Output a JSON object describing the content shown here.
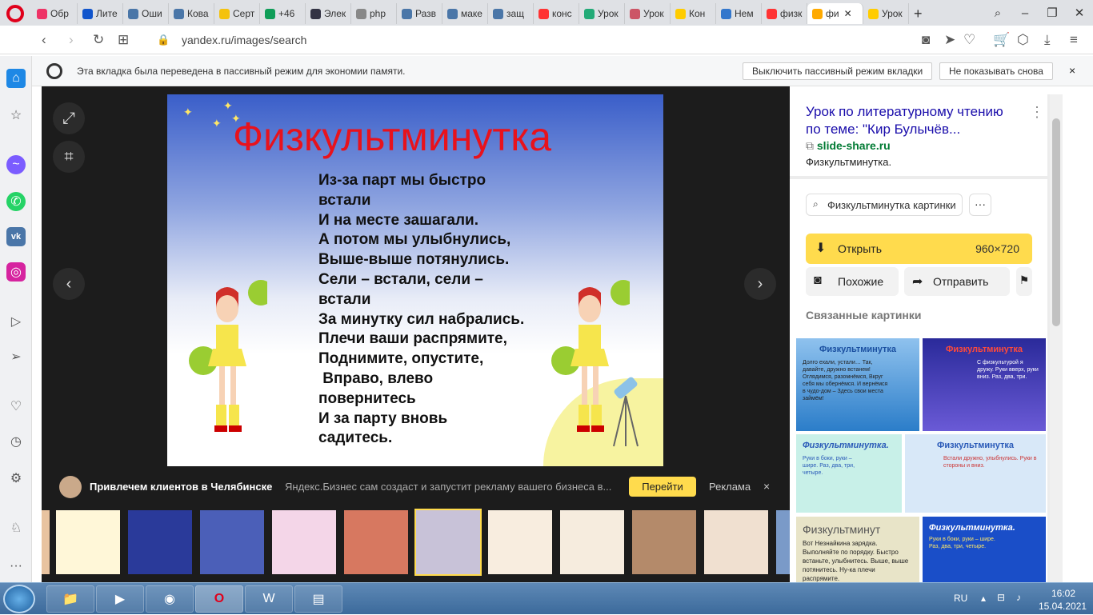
{
  "browser": {
    "tabs": [
      {
        "label": "Обр",
        "color": "#e36"
      },
      {
        "label": "Лите",
        "color": "#15c"
      },
      {
        "label": "Оши",
        "color": "#4a76a8"
      },
      {
        "label": "Кова",
        "color": "#4a76a8"
      },
      {
        "label": "Серт",
        "color": "#f4c20d"
      },
      {
        "label": "+46",
        "color": "#0f9d58"
      },
      {
        "label": "Элек",
        "color": "#334"
      },
      {
        "label": "php",
        "color": "#888"
      },
      {
        "label": "Разв",
        "color": "#4a76a8"
      },
      {
        "label": "маке",
        "color": "#4a76a8"
      },
      {
        "label": "защ",
        "color": "#4a76a8"
      },
      {
        "label": "конс",
        "color": "#f33"
      },
      {
        "label": "Урок",
        "color": "#2a7"
      },
      {
        "label": "Урок",
        "color": "#c56"
      },
      {
        "label": "Кон",
        "color": "#fc0"
      },
      {
        "label": "Нем",
        "color": "#37c"
      },
      {
        "label": "физк",
        "color": "#f33"
      },
      {
        "label": "фи",
        "color": "#fa0"
      },
      {
        "label": "Урок",
        "color": "#fc0"
      }
    ],
    "new_tab": "+",
    "url": "yandex.ru/images/search"
  },
  "infobar": {
    "text": "Эта вкладка была переведена в пассивный режим для экономии памяти.",
    "btn_disable": "Выключить пассивный режим вкладки",
    "btn_hide": "Не показывать снова",
    "close": "×"
  },
  "slide": {
    "title": "Физкультминутка",
    "poem": [
      "Из-за парт мы быстро",
      "встали",
      "И на месте зашагали.",
      "А потом мы улыбнулись,",
      "Выше-выше потянулись.",
      "Сели – встали, сели –",
      "встали",
      "За минутку сил набрались.",
      "Плечи ваши распрямите,",
      "Поднимите, опустите,",
      " Вправо, влево",
      "повернитесь",
      "И за парту вновь",
      "садитесь."
    ]
  },
  "ad": {
    "title": "Привлечем клиентов в Челябинске",
    "desc": "Яндекс.Бизнес сам создаст и запустит рекламу вашего бизнеса в...",
    "go": "Перейти",
    "label": "Реклама",
    "close": "×"
  },
  "panel": {
    "title": "Урок по литературному чтению по теме: \"Кир Булычёв...",
    "site": "slide-share.ru",
    "caption": "Физкультминутка.",
    "search_chip": "Физкультминутка картинки",
    "more": "···",
    "open_label": "Открыть",
    "open_size": "960×720",
    "similar": "Похожие",
    "share": "Отправить",
    "related_heading": "Связанные картинки",
    "related": [
      {
        "title": "Физкультминутка",
        "text": "Долго ехали, устали… Так, давайте, дружно встанем! Оглядимся, разомнёмся, Вкруг себя мы обернёмся. И вернёмся в чудо-дом – Здесь свои места займём!"
      },
      {
        "title": "Физкультминутка",
        "text": "С физкультурой я дружу. Руки вверх, руки вниз. Раз, два, три."
      },
      {
        "title": "Физкультминутка.",
        "text": "Руки в боки, руки – шире. Раз, два, три, четыре."
      },
      {
        "title": "Физкультминутка",
        "text": "Встали дружно, улыбнулись. Руки в стороны и вниз."
      },
      {
        "title": "Физкультминут",
        "text": "Вот Незнайкина зарядка. Выполняйте по порядку. Быстро встаньте, улыбнитесь. Выше, выше потянитесь. Ну-ка плечи распрямите."
      },
      {
        "title": "Физкультминутка.",
        "text": "Руки в боки, руки – шире. Раз, два, три, четыре."
      }
    ]
  },
  "taskbar": {
    "lang": "RU",
    "time": "16:02",
    "date": "15.04.2021"
  }
}
